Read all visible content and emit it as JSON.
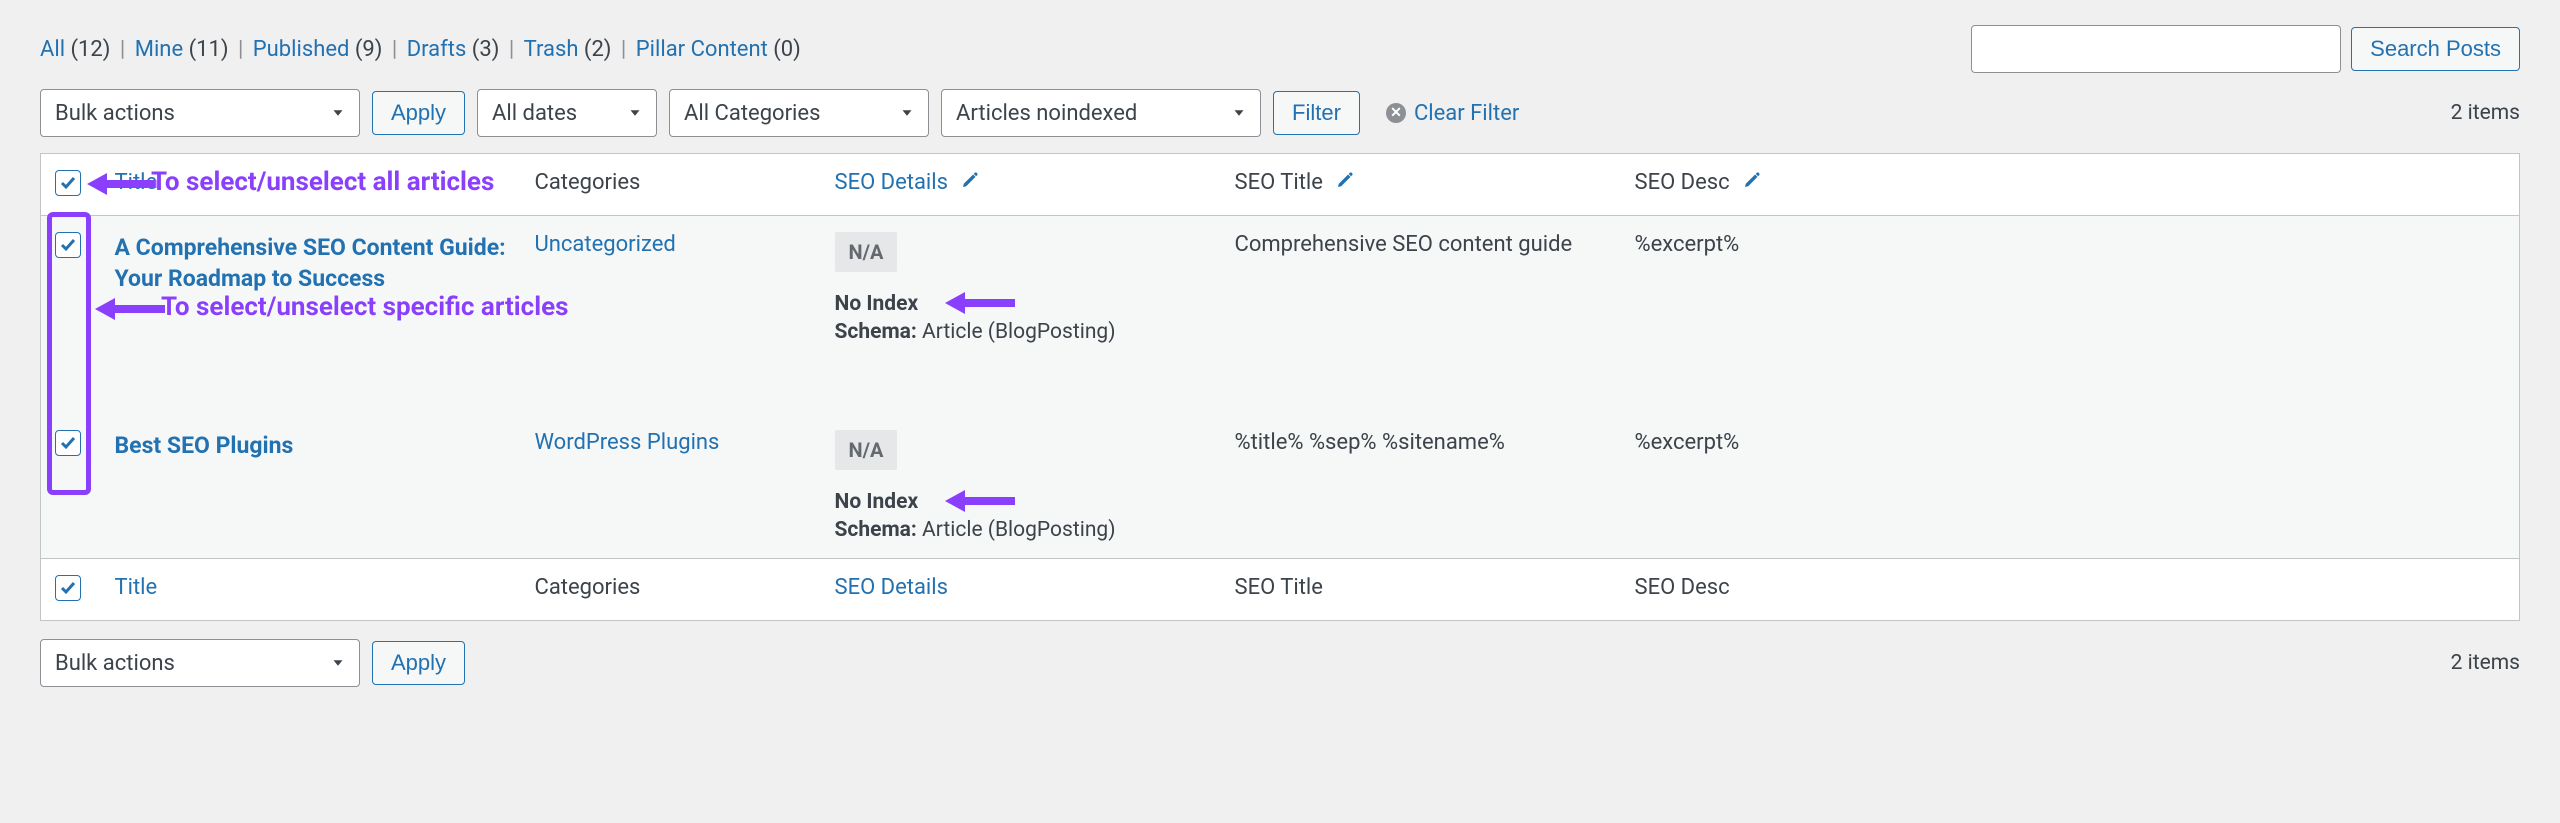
{
  "status_links": [
    {
      "label": "All",
      "count": 12
    },
    {
      "label": "Mine",
      "count": 11
    },
    {
      "label": "Published",
      "count": 9
    },
    {
      "label": "Drafts",
      "count": 3
    },
    {
      "label": "Trash",
      "count": 2
    },
    {
      "label": "Pillar Content",
      "count": 0
    }
  ],
  "search": {
    "button": "Search Posts",
    "value": ""
  },
  "filters": {
    "bulk": "Bulk actions",
    "apply": "Apply",
    "dates": "All dates",
    "categories": "All Categories",
    "rank_filter": "Articles noindexed",
    "filter_btn": "Filter",
    "clear_filter": "Clear Filter",
    "items_text": "2 items"
  },
  "columns": {
    "title": "Title",
    "categories": "Categories",
    "seo_details": "SEO Details",
    "seo_title": "SEO Title",
    "seo_desc": "SEO Desc"
  },
  "rows": [
    {
      "checked": true,
      "title": "A Comprehensive SEO Content Guide: Your Roadmap to Success",
      "category": "Uncategorized",
      "seo_badge": "N/A",
      "noindex": "No Index",
      "schema_label": "Schema:",
      "schema_value": "Article (BlogPosting)",
      "seo_title": "Comprehensive SEO content guide",
      "seo_desc": "%excerpt%"
    },
    {
      "checked": true,
      "title": "Best SEO Plugins",
      "category": "WordPress Plugins",
      "seo_badge": "N/A",
      "noindex": "No Index",
      "schema_label": "Schema:",
      "schema_value": "Article (BlogPosting)",
      "seo_title": "%title% %sep% %sitename%",
      "seo_desc": "%excerpt%"
    }
  ],
  "annotations": {
    "select_all": "To select/unselect all articles",
    "select_specific": "To select/unselect specific articles"
  },
  "header_footer_checked": true
}
